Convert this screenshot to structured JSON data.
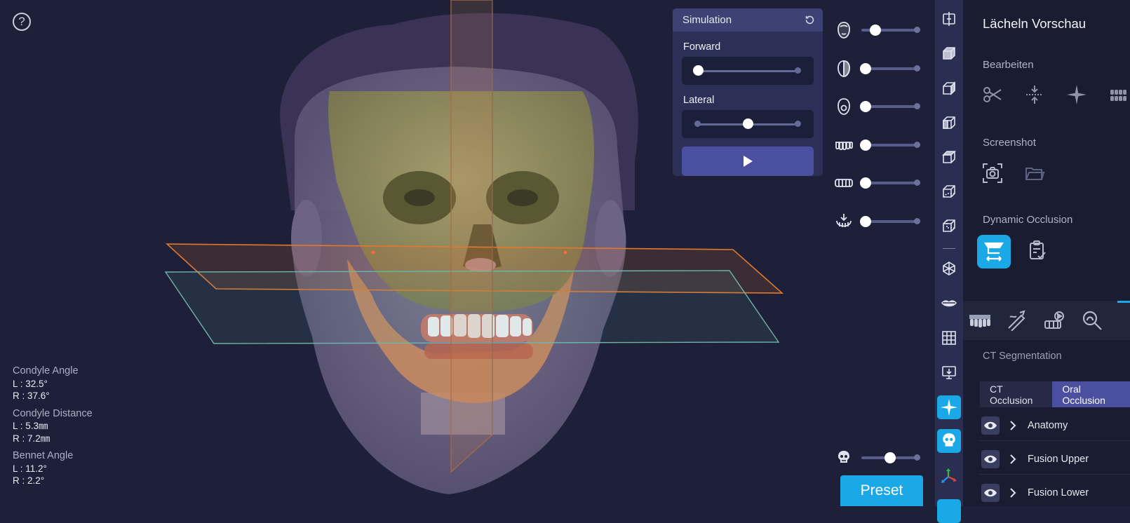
{
  "help": {
    "glyph": "?"
  },
  "measurements": {
    "condyle_angle": {
      "label": "Condyle Angle",
      "left": "L : 32.5°",
      "right": "R : 37.6°"
    },
    "condyle_distance": {
      "label": "Condyle Distance",
      "left": "L : 5.3㎜",
      "right": "R : 7.2㎜"
    },
    "bennet_angle": {
      "label": "Bennet Angle",
      "left": "L : 11.2°",
      "right": "R : 2.2°"
    }
  },
  "simulation": {
    "title": "Simulation",
    "forward": {
      "label": "Forward",
      "value": 0.0
    },
    "lateral": {
      "label": "Lateral",
      "value": 0.5
    }
  },
  "visibility_sliders": [
    {
      "icon": "face-front-icon",
      "value": 0.2
    },
    {
      "icon": "face-side-icon",
      "value": 0.0
    },
    {
      "icon": "face-skin-icon",
      "value": 0.0
    },
    {
      "icon": "upper-teeth-icon",
      "value": 0.0
    },
    {
      "icon": "lower-teeth-icon",
      "value": 0.0
    },
    {
      "icon": "jaw-download-icon",
      "value": 0.0
    }
  ],
  "skull_slider": {
    "icon": "skull-icon",
    "value": 0.5
  },
  "preset_label": "Preset",
  "toolbar": [
    "split-view-icon",
    "cube-front-icon",
    "cube-right-icon",
    "cube-left-icon",
    "cube-top-icon",
    "cube-bottom-icon",
    "cube-back-icon",
    "transform-icon",
    "lips-icon",
    "grid-icon",
    "monitor-icon",
    "sparkle-icon",
    "skull-icon",
    "axes-icon"
  ],
  "toolbar_active": [
    "sparkle-icon",
    "skull-icon"
  ],
  "panel": {
    "title": "Lächeln Vorschau",
    "bearbeiten": "Bearbeiten",
    "screenshot": "Screenshot",
    "dynamic_occlusion": "Dynamic Occlusion",
    "ct_segmentation": "CT Segmentation",
    "occlusion_tabs": [
      {
        "label": "CT Occlusion",
        "active": false
      },
      {
        "label": "Oral Occlusion",
        "active": true
      }
    ],
    "tree": [
      {
        "label": "Anatomy"
      },
      {
        "label": "Fusion Upper"
      },
      {
        "label": "Fusion Lower"
      }
    ]
  },
  "colors": {
    "accent": "#1aa9e6",
    "purple": "#4a4fa0",
    "background": "#1d2038",
    "orange_plane": "#e2782c",
    "teal_plane": "#5fa8a0"
  }
}
